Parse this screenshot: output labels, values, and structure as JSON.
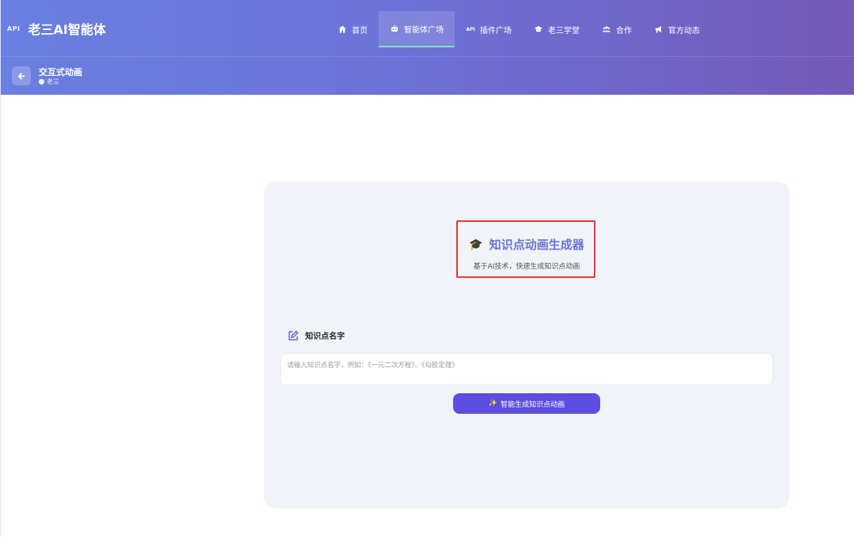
{
  "header": {
    "api_badge": "API",
    "app_title": "老三AI智能体",
    "nav": [
      {
        "label": "首页",
        "icon": "home-icon"
      },
      {
        "label": "智能体广场",
        "icon": "robot-icon",
        "active": true
      },
      {
        "label": "插件广场",
        "icon": "api-icon",
        "icon_text": "API"
      },
      {
        "label": "老三学堂",
        "icon": "graduation-cap-icon"
      },
      {
        "label": "合作",
        "icon": "users-icon"
      },
      {
        "label": "官方动态",
        "icon": "bullhorn-icon"
      }
    ],
    "accent_active_underline": "#7fe0c0"
  },
  "subbar": {
    "title": "交互式动画",
    "author": "老三"
  },
  "generator": {
    "icon": "🎓",
    "title": "知识点动画生成器",
    "subtitle": "基于AI技术，快速生成知识点动画",
    "field_label": "知识点名字",
    "input_placeholder": "请输入知识点名字，例如：《一元二次方程》、《勾股定理》",
    "input_value": "",
    "button_icon": "✨",
    "button_label": "智能生成知识点动画"
  },
  "colors": {
    "header_start": "#6a7fe0",
    "header_end": "#7459b8",
    "title_color": "#6a74d9",
    "button_bg": "#5b4ee0",
    "highlight_border": "#e0393e"
  }
}
